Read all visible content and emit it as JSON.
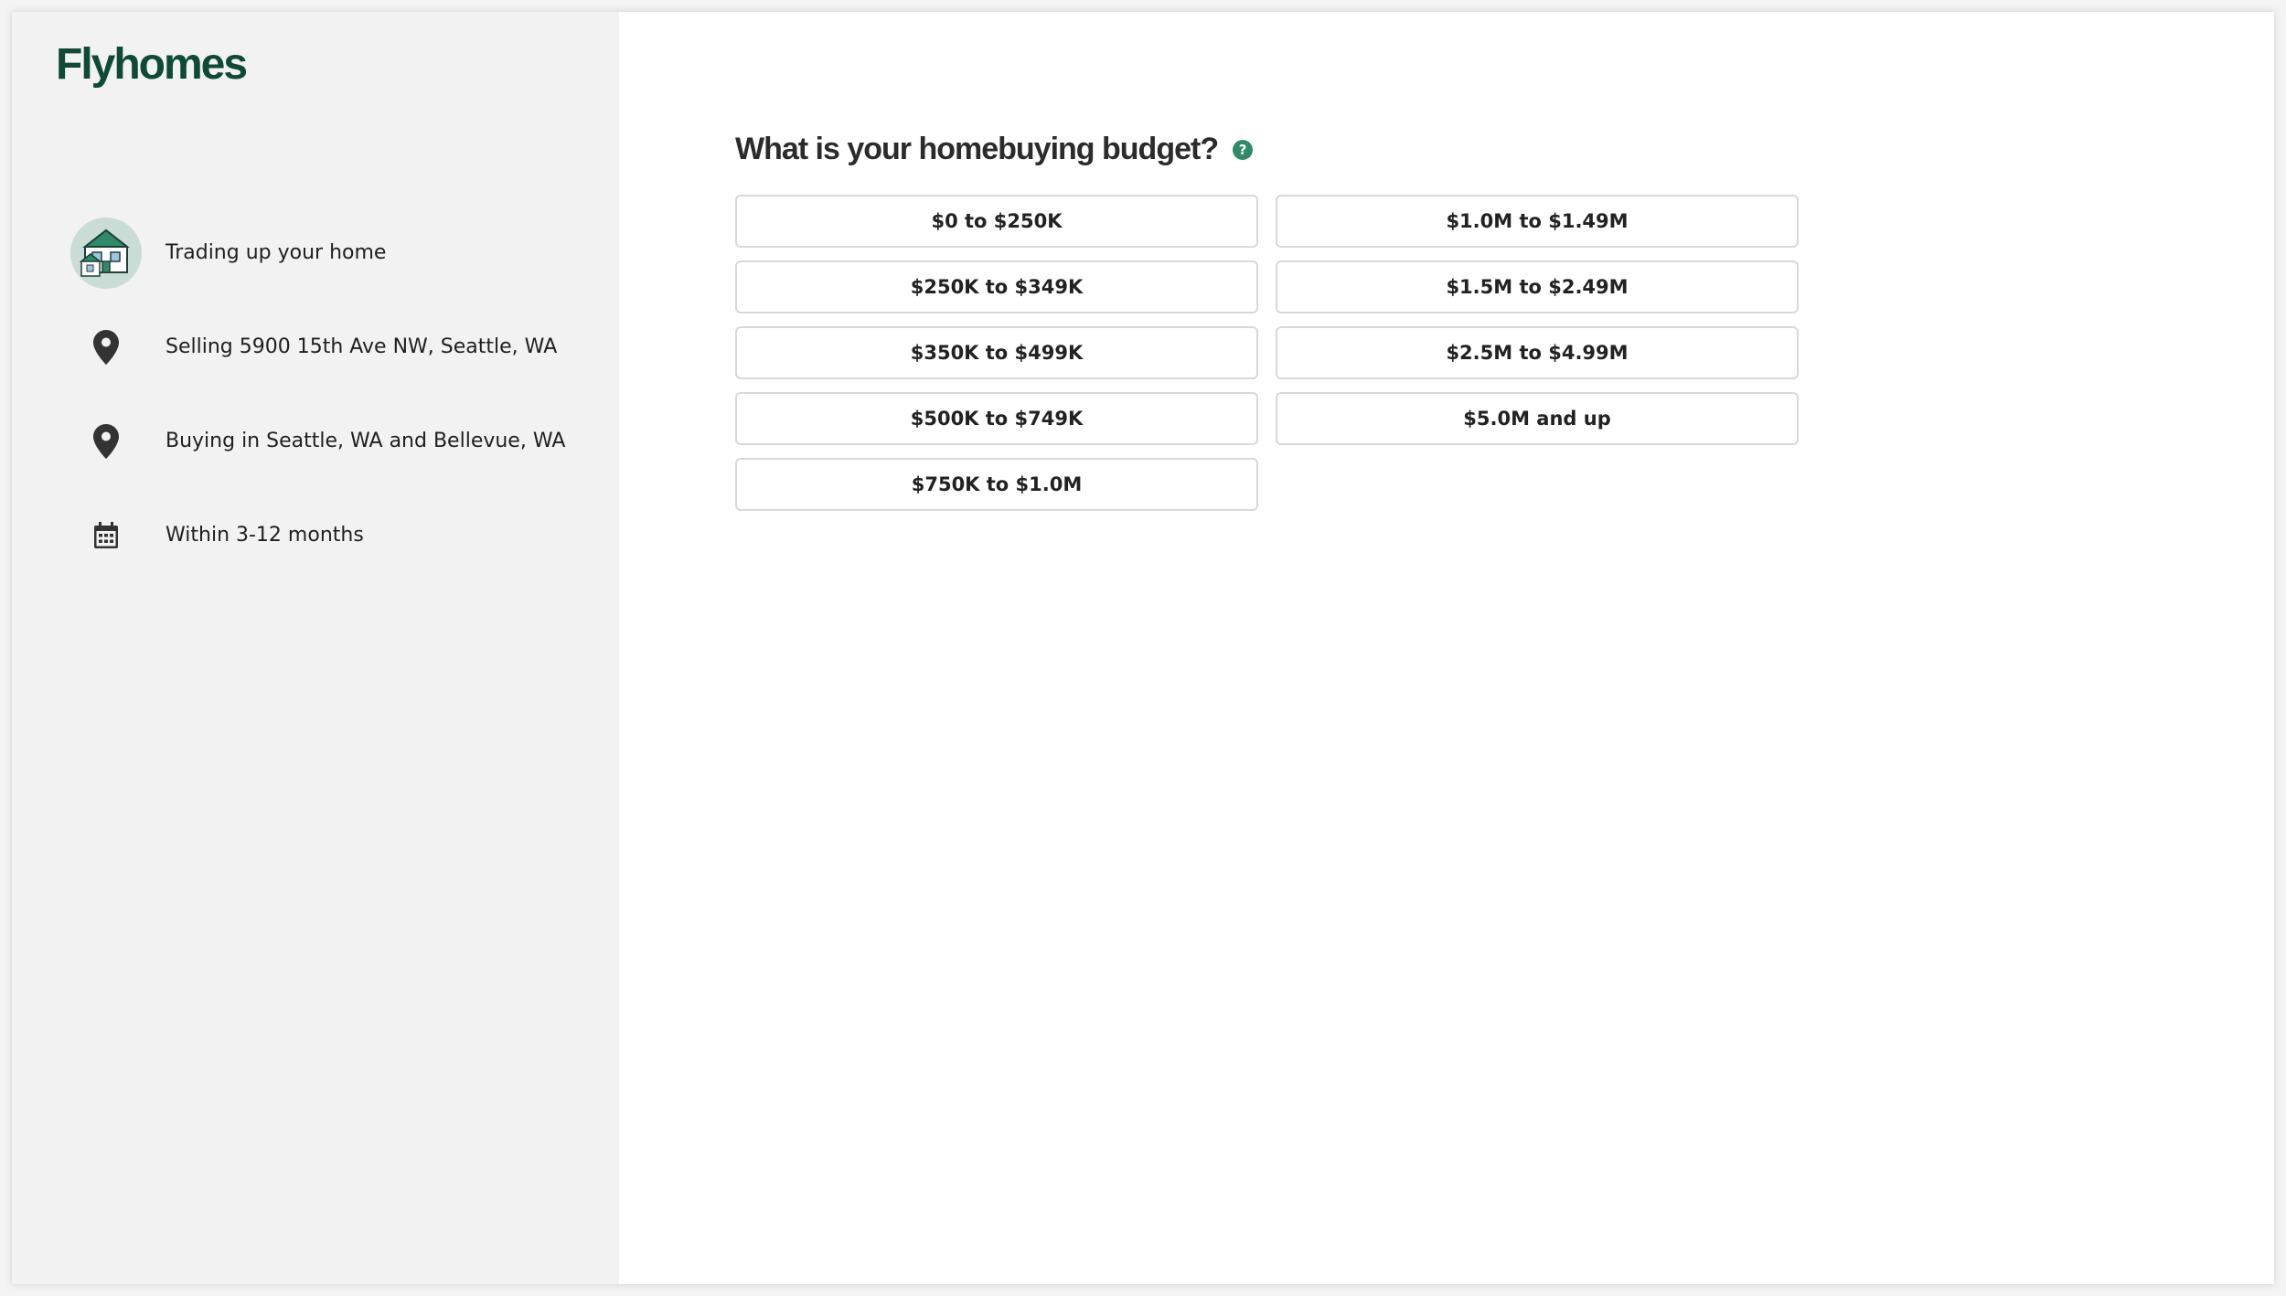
{
  "brand": {
    "logo_text": "Flyhomes",
    "color": "#0f4a36",
    "accent": "#2f8a68"
  },
  "summary": {
    "items": [
      {
        "icon": "house-illustration-icon",
        "label": "Trading up your home"
      },
      {
        "icon": "location-pin-icon",
        "label": "Selling 5900 15th Ave NW, Seattle, WA"
      },
      {
        "icon": "location-pin-icon",
        "label": "Buying in Seattle, WA and Bellevue, WA"
      },
      {
        "icon": "calendar-icon",
        "label": "Within 3-12 months"
      }
    ]
  },
  "question": {
    "title": "What is your homebuying budget?",
    "help_glyph": "?"
  },
  "options": [
    "$0 to $250K",
    "$250K to $349K",
    "$350K to $499K",
    "$500K to $749K",
    "$750K to $1.0M",
    "$1.0M to $1.49M",
    "$1.5M to $2.49M",
    "$2.5M to $4.99M",
    "$5.0M and up"
  ]
}
